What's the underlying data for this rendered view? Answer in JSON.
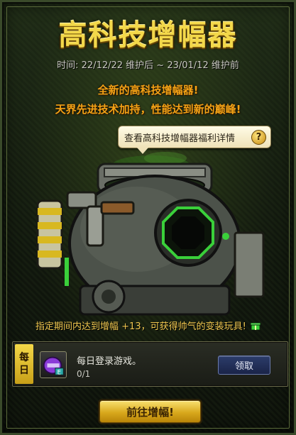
{
  "event": {
    "title": "高科技增幅器",
    "period": "时间: 22/12/22 维护后 ~ 23/01/12 维护前",
    "tagline1": "全新的高科技增幅器!",
    "tagline2": "天界先进技术加持，性能达到新的巅峰!",
    "details_link": "查看高科技增幅器福利详情",
    "help_icon": "?",
    "reward_text": "指定期间内达到增幅 +13，可获得帅气的变装玩具!"
  },
  "task": {
    "day_label_top": "每",
    "day_label_bottom": "日",
    "name": "每日登录游戏。",
    "progress": "0/1",
    "claim_label": "领取",
    "icon": "purple-helmet-icon"
  },
  "footer": {
    "go_label": "前往增幅!"
  },
  "colors": {
    "title": "#f3d84a",
    "tagline": "#f2a216",
    "claim_button": "#1a2448",
    "go_button": "#d8a81c"
  }
}
